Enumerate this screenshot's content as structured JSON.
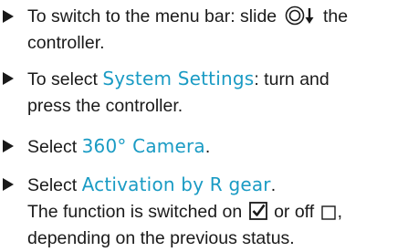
{
  "steps": [
    {
      "pre": "To switch to the menu bar: slide",
      "post": "the",
      "line2": "controller."
    },
    {
      "pre": "To select ",
      "menu": "System Settings",
      "post": ": turn and",
      "line2": "press the controller."
    },
    {
      "pre": "Select ",
      "menu": "360° Camera",
      "post": "."
    },
    {
      "pre": "Select ",
      "menu": "Activation by R gear",
      "post": ".",
      "line2_pre": "The function is switched on",
      "line2_mid": "or off",
      "line2_post": ",",
      "line3": "depending on the previous status."
    }
  ],
  "icons": {
    "bullet": "triangle-bullet-icon",
    "controller_slide": "controller-slide-down-icon",
    "checkbox_on": "checkbox-checked-icon",
    "checkbox_off": "checkbox-empty-icon"
  },
  "colors": {
    "menu_text": "#1a9bc4",
    "body_text": "#1a1a1a"
  }
}
